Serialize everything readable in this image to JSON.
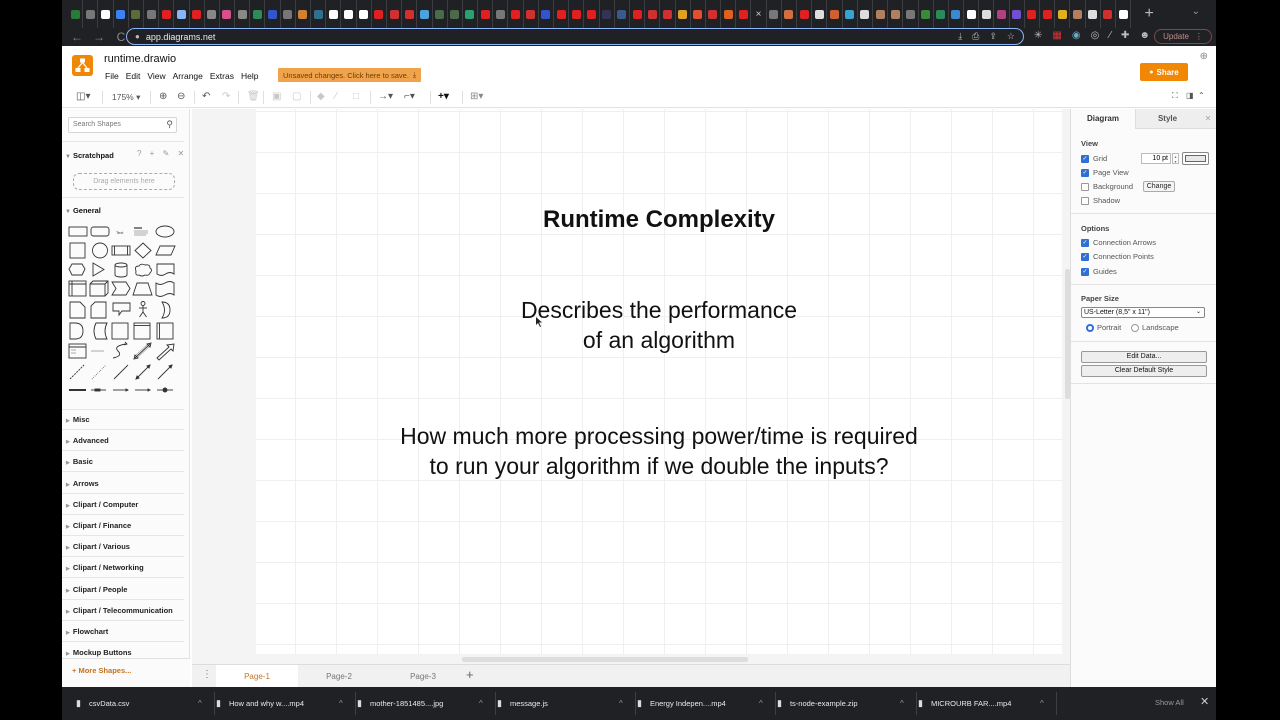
{
  "browser": {
    "tab_favicon_colors": [
      "#2a7a3a",
      "#777",
      "#fff",
      "#3b82f6",
      "#5b6b3b",
      "#777",
      "#e02020",
      "#8ab4f8",
      "#e02020",
      "#888",
      "#d94f8a",
      "#888",
      "#2e8b57",
      "#3355cc",
      "#777",
      "#d08030",
      "#2f6f8f",
      "#fff",
      "#fff",
      "#fff",
      "#e02020",
      "#d03030",
      "#d03030",
      "#4aa3df",
      "#4a6a4a",
      "#4a6a4a",
      "#2aa070",
      "#e02020",
      "#777",
      "#e02020",
      "#d03030",
      "#3355cc",
      "#e02020",
      "#e02020",
      "#e02020",
      "#335",
      "#3a5a8a",
      "#e02020",
      "#d03030",
      "#d03030",
      "#e0a020",
      "#e05030",
      "#d03030",
      "#e06020",
      "#e02020",
      "#777",
      "#d07040",
      "#e02020",
      "#ddd",
      "#d06030",
      "#3aa0d0",
      "#ddd",
      "#b08060",
      "#b08060",
      "#777",
      "#3a8a3a",
      "#2a8a5a",
      "#3a8ad0",
      "#fff",
      "#ddd",
      "#b04080",
      "#7050d0",
      "#e02020",
      "#e02020",
      "#e0b020",
      "#b08060",
      "#ddd",
      "#d03030",
      "#fff"
    ],
    "close_tab_glyph": "×",
    "new_tab_label": "+",
    "tab_menu_label": "⌄",
    "nav": {
      "back": "←",
      "forward": "→",
      "reload": "C"
    },
    "address": "app.diagrams.net",
    "lock_icon": "🔒",
    "omnibox_icons": [
      "⤓",
      "⎙",
      "⇪",
      "☆"
    ],
    "extension_icons": [
      "✳",
      "▦",
      "◉",
      "◎",
      "⁄",
      "✚",
      "☻"
    ],
    "update_label": "Update",
    "update_menu": "⋮"
  },
  "app": {
    "file_name": "runtime.drawio",
    "menu": [
      "File",
      "Edit",
      "View",
      "Arrange",
      "Extras",
      "Help"
    ],
    "unsaved_banner": "Unsaved changes. Click here to save.",
    "unsaved_icon": "⤓",
    "share_label": "Share",
    "share_icon": "👤",
    "globe_icon": "⊕",
    "zoom_level": "175%",
    "toolbar_glyphs": {
      "format_panel": "◫▾",
      "zoom_in": "⊕",
      "zoom_out": "⊖",
      "undo": "↶",
      "redo": "↷",
      "delete": "🗑",
      "to_front": "▣",
      "to_back": "▢",
      "fill": "◆",
      "line": "∕",
      "shadow": "□",
      "connection": "→▾",
      "waypoints": "⌐▾",
      "insert": "+▾",
      "table": "⊞▾",
      "fullscreen": "⛶",
      "toggle_panel": "◨",
      "collapse": "⌃"
    }
  },
  "sidebar": {
    "search_placeholder": "Search Shapes",
    "search_icon": "⚲",
    "scratchpad_title": "Scratchpad",
    "scratchpad_tools": "? + ✎ ✕",
    "drag_hint": "Drag elements here",
    "general_title": "General",
    "categories": [
      "Misc",
      "Advanced",
      "Basic",
      "Arrows",
      "Clipart / Computer",
      "Clipart / Finance",
      "Clipart / Various",
      "Clipart / Networking",
      "Clipart / People",
      "Clipart / Telecommunication",
      "Flowchart",
      "Mockup Buttons"
    ],
    "more_shapes": "+ More Shapes..."
  },
  "canvas": {
    "title": "Runtime Complexity",
    "description_line1": "Describes the performance",
    "description_line2": "of an algorithm",
    "question_line1": "How much more processing power/time is required",
    "question_line2": "to run your algorithm if we double the inputs?"
  },
  "pages": {
    "menu_icon": "⋮",
    "tabs": [
      "Page-1",
      "Page-2",
      "Page-3"
    ],
    "active": "Page-1",
    "add_icon": "+"
  },
  "format_panel": {
    "tabs": [
      "Diagram",
      "Style"
    ],
    "close_icon": "✕",
    "view_label": "View",
    "grid_label": "Grid",
    "grid_checked": true,
    "grid_size": "10 pt",
    "page_view_label": "Page View",
    "page_view_checked": true,
    "background_label": "Background",
    "background_checked": false,
    "change_label": "Change",
    "shadow_label": "Shadow",
    "shadow_checked": false,
    "options_label": "Options",
    "connection_arrows_label": "Connection Arrows",
    "connection_points_label": "Connection Points",
    "guides_label": "Guides",
    "paper_size_label": "Paper Size",
    "paper_size_value": "US-Letter (8,5\" x 11\")",
    "portrait_label": "Portrait",
    "landscape_label": "Landscape",
    "orientation": "Portrait",
    "edit_data_label": "Edit Data...",
    "clear_style_label": "Clear Default Style"
  },
  "downloads": {
    "items": [
      {
        "name": "csvData.csv"
      },
      {
        "name": "How and why w....mp4"
      },
      {
        "name": "mother-1851485....jpg"
      },
      {
        "name": "message.js"
      },
      {
        "name": "Energy Indepen....mp4"
      },
      {
        "name": "ts-node-example.zip"
      },
      {
        "name": "MICROURB FAR....mp4"
      }
    ],
    "show_all": "Show All",
    "close_icon": "✕",
    "chevron": "^"
  }
}
